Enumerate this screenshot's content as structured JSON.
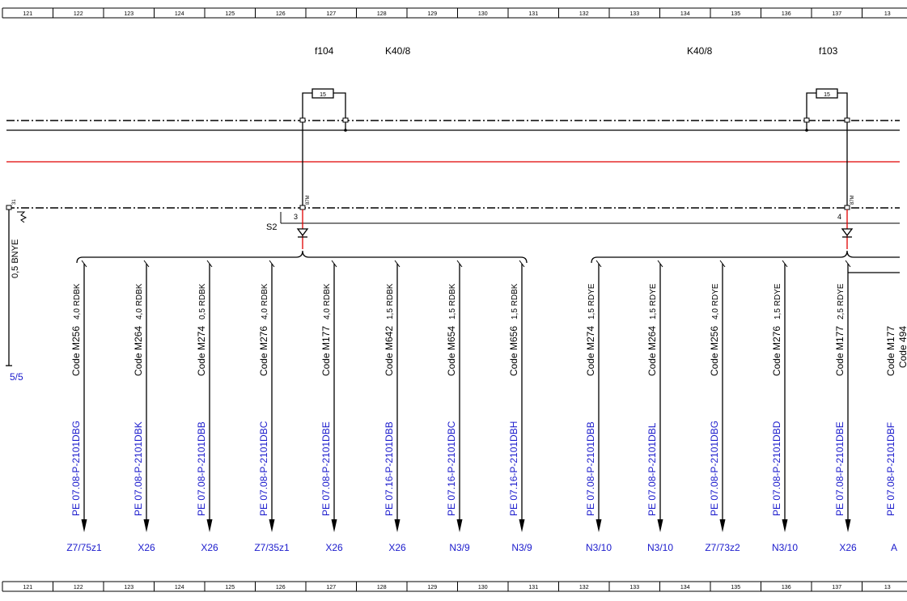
{
  "ruler": {
    "labels": [
      "121",
      "122",
      "123",
      "124",
      "125",
      "126",
      "127",
      "128",
      "129",
      "130",
      "131",
      "132",
      "133",
      "134",
      "135",
      "136",
      "137",
      "13"
    ]
  },
  "fuses": [
    {
      "name": "f104",
      "rating": "15",
      "relay": "K40/8",
      "connector": "S2",
      "pin": "3",
      "pin_label": "87M"
    },
    {
      "name": "f103",
      "rating": "15",
      "relay": "K40/8",
      "pin": "4",
      "pin_label": "87M"
    }
  ],
  "ground_stub": {
    "pin_label": "31",
    "wire": "0,5 BNYE",
    "reference": "5/5"
  },
  "branches": [
    {
      "wire": "4,0 RDBK",
      "code": "Code M256",
      "doc": "PE 07.08-P-2101DBG",
      "dest": "Z7/75z1"
    },
    {
      "wire": "4,0 RDBK",
      "code": "Code M264",
      "doc": "PE 07.08-P-2101DBK",
      "dest": "X26"
    },
    {
      "wire": "0,5 RDBK",
      "code": "Code M274",
      "doc": "PE 07.08-P-2101DBB",
      "dest": "X26"
    },
    {
      "wire": "4,0 RDBK",
      "code": "Code M276",
      "doc": "PE 07.08-P-2101DBC",
      "dest": "Z7/35z1"
    },
    {
      "wire": "4,0 RDBK",
      "code": "Code M177",
      "doc": "PE 07.08-P-2101DBE",
      "dest": "X26"
    },
    {
      "wire": "1,5 RDBK",
      "code": "Code M642",
      "doc": "PE 07.16-P-2101DBB",
      "dest": "X26"
    },
    {
      "wire": "1,5 RDBK",
      "code": "Code M654",
      "doc": "PE 07.16-P-2101DBC",
      "dest": "N3/9"
    },
    {
      "wire": "1,5 RDBK",
      "code": "Code M656",
      "doc": "PE 07.16-P-2101DBH",
      "dest": "N3/9"
    },
    {
      "wire": "1,5 RDYE",
      "code": "Code M274",
      "doc": "PE 07.08-P-2101DBB",
      "dest": "N3/10"
    },
    {
      "wire": "1,5 RDYE",
      "code": "Code M264",
      "doc": "PE 07.08-P-2101DBL",
      "dest": "N3/10"
    },
    {
      "wire": "4,0 RDYE",
      "code": "Code M256",
      "doc": "PE 07.08-P-2101DBG",
      "dest": "Z7/73z2"
    },
    {
      "wire": "1,5 RDYE",
      "code": "Code M276",
      "doc": "PE 07.08-P-2101DBD",
      "dest": "N3/10"
    },
    {
      "wire": "2,5 RDYE",
      "code": "Code M177",
      "doc": "PE 07.08-P-2101DBE",
      "dest": "X26"
    },
    {
      "wire": "",
      "code": "Code M177",
      "code2": "Code 494",
      "doc": "PE 07.08-P-2101DBF",
      "dest": "A"
    }
  ],
  "colors": {
    "line": "#000000",
    "supply_line": "#e00000",
    "reference_text": "#1a1acc"
  }
}
